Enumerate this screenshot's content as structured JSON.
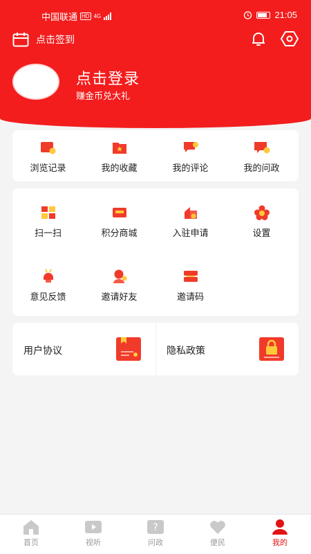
{
  "status_bar": {
    "carrier": "中国联通",
    "hd": "HD",
    "network": "4G",
    "time": "21:05"
  },
  "header": {
    "checkin_label": "点击签到",
    "login_title": "点击登录",
    "login_subtitle": "赚金币兑大礼"
  },
  "quick_links": [
    {
      "label": "浏览记录",
      "icon": "history-icon"
    },
    {
      "label": "我的收藏",
      "icon": "favorite-folder-icon"
    },
    {
      "label": "我的评论",
      "icon": "comment-icon"
    },
    {
      "label": "我的问政",
      "icon": "inquiry-icon"
    }
  ],
  "tools": [
    {
      "label": "扫一扫",
      "icon": "scan-icon"
    },
    {
      "label": "积分商城",
      "icon": "points-mall-icon"
    },
    {
      "label": "入驻申请",
      "icon": "apply-icon"
    },
    {
      "label": "设置",
      "icon": "settings-flower-icon"
    },
    {
      "label": "意见反馈",
      "icon": "feedback-icon"
    },
    {
      "label": "邀请好友",
      "icon": "invite-friend-icon"
    },
    {
      "label": "邀请码",
      "icon": "invite-code-icon"
    }
  ],
  "agreements": {
    "user_agreement": "用户协议",
    "privacy_policy": "隐私政策"
  },
  "tabbar": [
    {
      "label": "首页",
      "icon": "home-icon"
    },
    {
      "label": "视听",
      "icon": "video-icon"
    },
    {
      "label": "问政",
      "icon": "question-icon"
    },
    {
      "label": "便民",
      "icon": "heart-icon"
    },
    {
      "label": "我的",
      "icon": "profile-icon",
      "active": true
    }
  ],
  "colors": {
    "brand_red": "#f31d1d",
    "tab_active": "#e31313",
    "tab_inactive": "#999999"
  }
}
